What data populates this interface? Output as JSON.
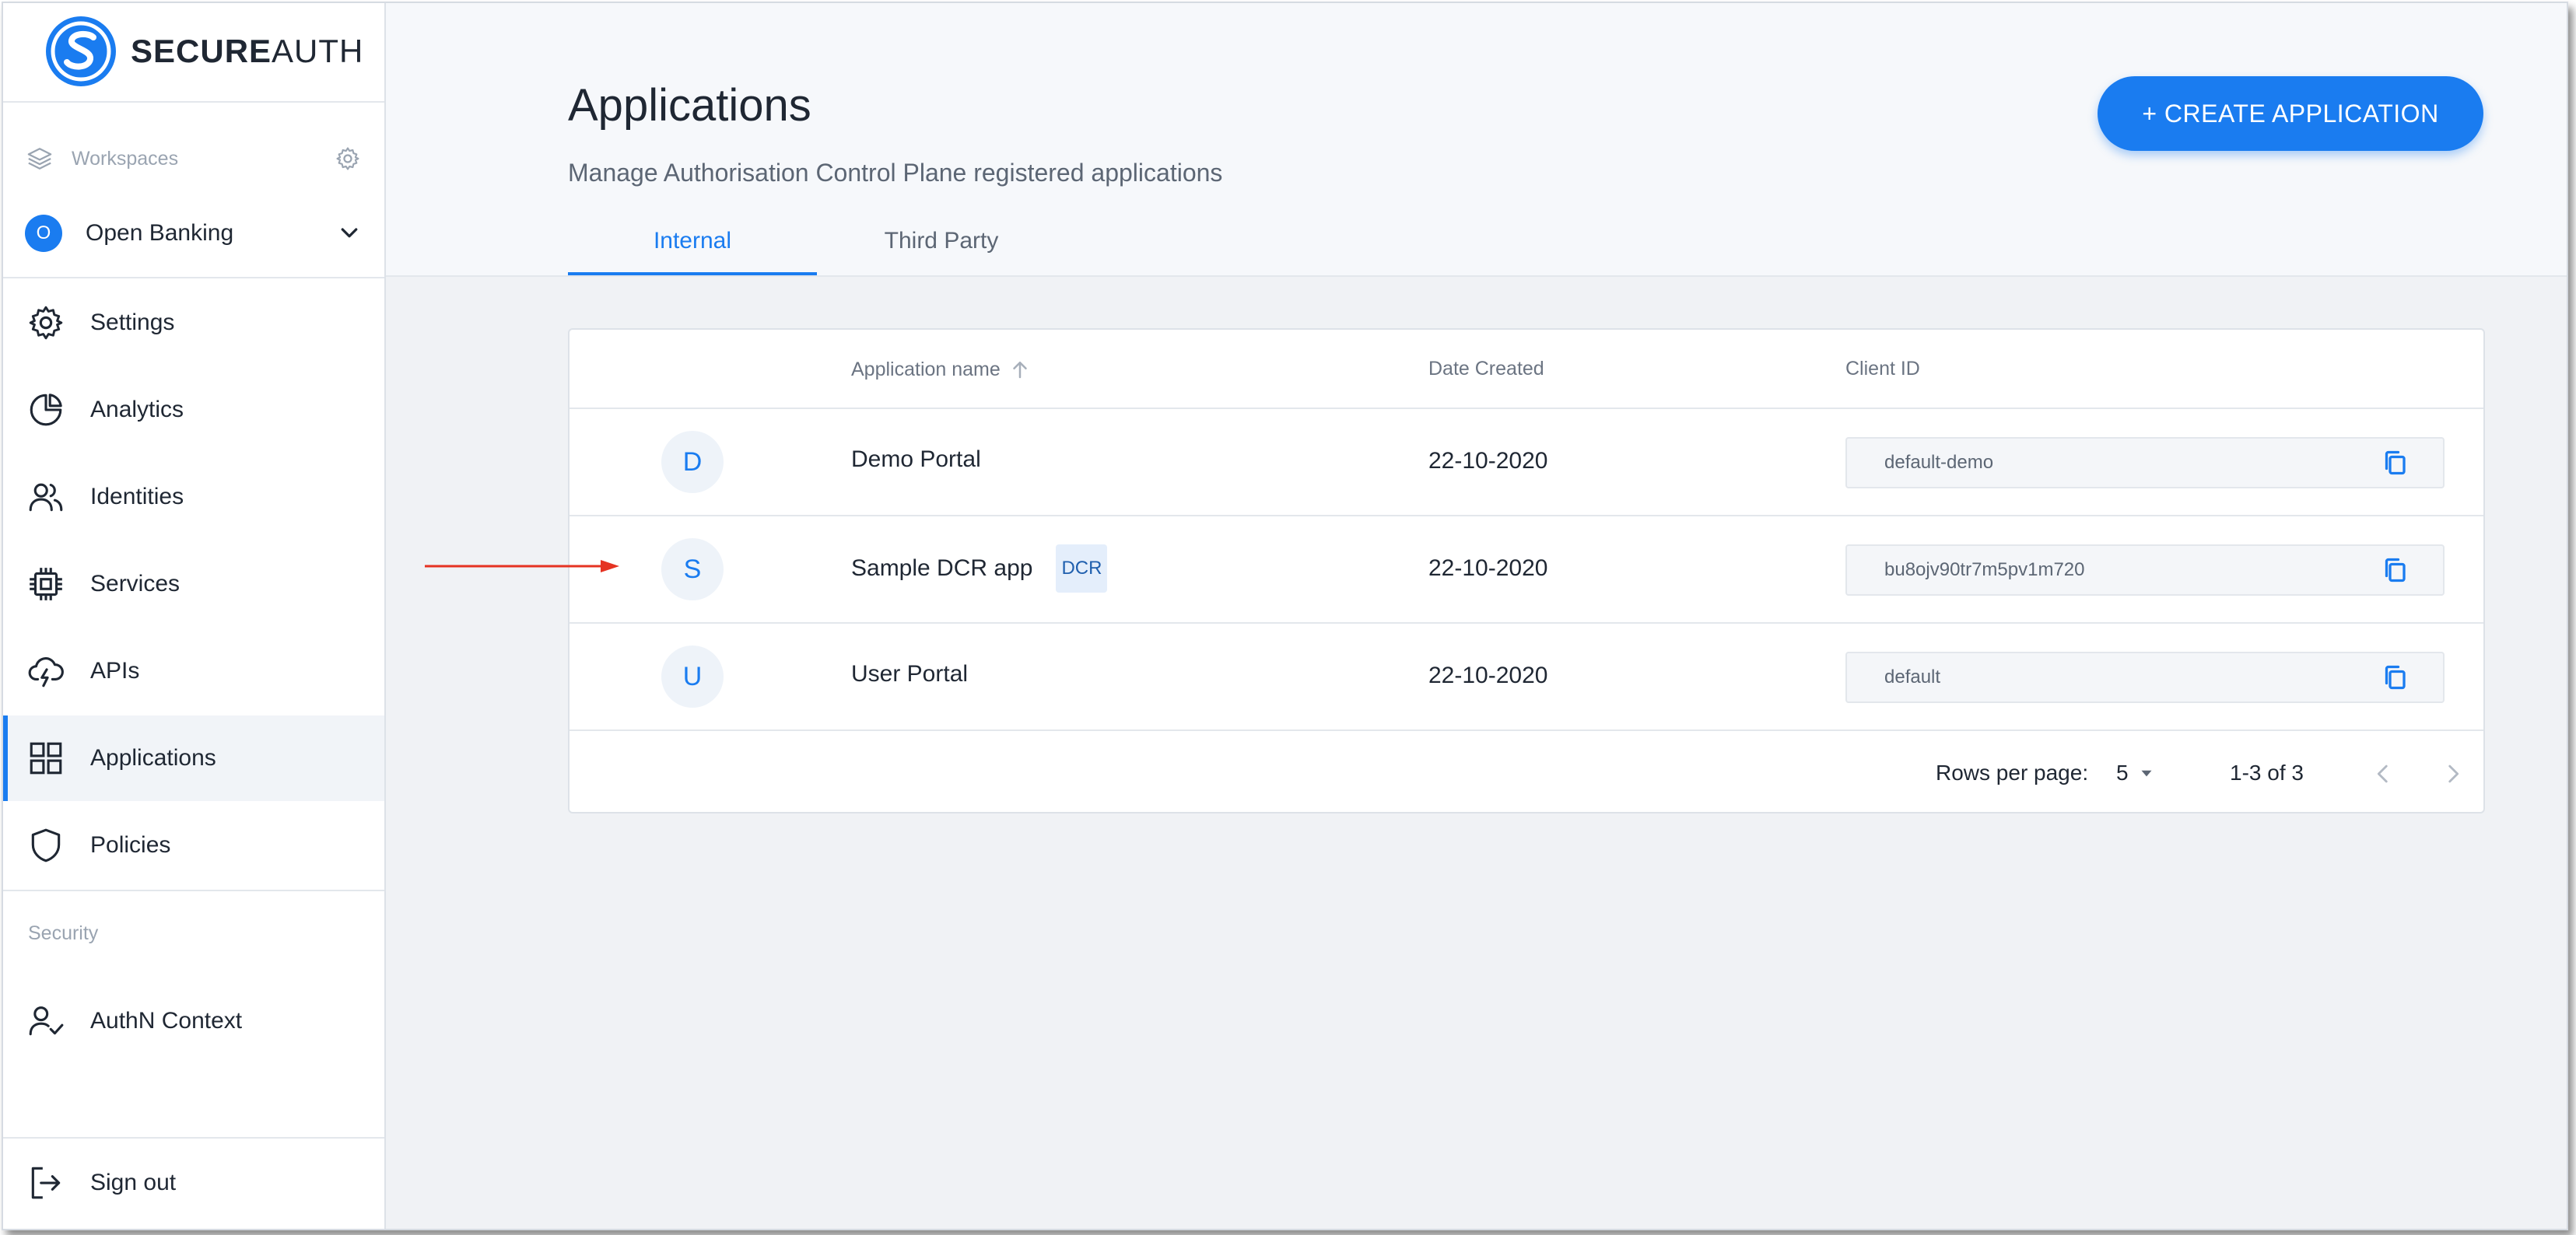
{
  "app": {
    "brand_bold": "SECURE",
    "brand_light": "AUTH"
  },
  "sidebar": {
    "workspaces_label": "Workspaces",
    "workspace": {
      "initial": "O",
      "name": "Open Banking"
    },
    "nav": [
      {
        "label": "Settings",
        "icon": "gear-icon"
      },
      {
        "label": "Analytics",
        "icon": "pie-chart-icon"
      },
      {
        "label": "Identities",
        "icon": "users-icon"
      },
      {
        "label": "Services",
        "icon": "chip-icon"
      },
      {
        "label": "APIs",
        "icon": "cloud-bolt-icon"
      },
      {
        "label": "Applications",
        "icon": "grid-icon",
        "active": true
      },
      {
        "label": "Policies",
        "icon": "shield-icon"
      }
    ],
    "security_label": "Security",
    "authn_label": "AuthN Context",
    "signout_label": "Sign out"
  },
  "main": {
    "title": "Applications",
    "subtitle": "Manage Authorisation Control Plane registered applications",
    "create_button": "+ CREATE APPLICATION",
    "tabs": [
      {
        "label": "Internal",
        "active": true
      },
      {
        "label": "Third Party",
        "active": false
      }
    ],
    "table": {
      "columns": {
        "name": "Application name",
        "date": "Date Created",
        "client": "Client ID"
      },
      "rows": [
        {
          "initial": "D",
          "name": "Demo Portal",
          "badge": "",
          "date": "22-10-2020",
          "client_id": "default-demo"
        },
        {
          "initial": "S",
          "name": "Sample DCR app",
          "badge": "DCR",
          "date": "22-10-2020",
          "client_id": "bu8ojv90tr7m5pv1m720"
        },
        {
          "initial": "U",
          "name": "User Portal",
          "badge": "",
          "date": "22-10-2020",
          "client_id": "default"
        }
      ],
      "footer": {
        "rows_per_page_label": "Rows per page:",
        "rows_per_page": "5",
        "range": "1-3 of 3"
      }
    }
  },
  "colors": {
    "accent": "#1a7cf0",
    "annotation_arrow": "#e53322"
  }
}
